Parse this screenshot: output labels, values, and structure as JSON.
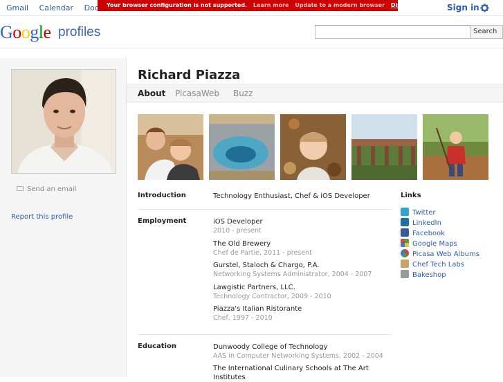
{
  "topbar": {
    "links": [
      "Gmail",
      "Calendar",
      "Docume"
    ],
    "sign_in": "Sign in",
    "warning": {
      "message": "Your browser configuration is not supported.",
      "learn_more": "Learn more",
      "update": "Update to a modern browser",
      "dismiss": "Dismiss"
    }
  },
  "header": {
    "logo_text": "Google",
    "logo_sub": "profiles",
    "search_placeholder": "",
    "search_button": "Search"
  },
  "sidebar": {
    "send_email": "Send an email",
    "report": "Report this profile"
  },
  "profile": {
    "name": "Richard Piazza",
    "tabs": [
      {
        "label": "About",
        "active": true
      },
      {
        "label": "PicasaWeb",
        "active": false
      },
      {
        "label": "Buzz",
        "active": false
      }
    ]
  },
  "sections": {
    "introduction": {
      "label": "Introduction",
      "text": "Technology Enthusiast, Chef & iOS Developer"
    },
    "employment": {
      "label": "Employment",
      "items": [
        {
          "title": "iOS Developer",
          "sub": "2010 - present"
        },
        {
          "title": "The Old Brewery",
          "sub": "Chef de Partie, 2011 - present"
        },
        {
          "title": "Gurstel, Staloch & Chargo, P.A.",
          "sub": "Networking Systems Administrator, 2004 - 2007"
        },
        {
          "title": "Lawgistic Partners, LLC.",
          "sub": "Technology Contractor, 2009 - 2010"
        },
        {
          "title": "Piazza's Italian Ristorante",
          "sub": "Chef, 1997 - 2010"
        }
      ]
    },
    "education": {
      "label": "Education",
      "items": [
        {
          "title": "Dunwoody College of Technology",
          "sub": "AAS in Computer Networking Systems, 2002 - 2004"
        },
        {
          "title": "The International Culinary Schools at The Art",
          "sub": "Institutes"
        }
      ]
    }
  },
  "links": {
    "title": "Links",
    "items": [
      {
        "label": "Twitter",
        "icon": "twitter-icon",
        "color": "#33a3d6"
      },
      {
        "label": "LinkedIn",
        "icon": "linkedin-icon",
        "color": "#1f6fa8"
      },
      {
        "label": "Facebook",
        "icon": "facebook-icon",
        "color": "#3b5998"
      },
      {
        "label": "Google Maps",
        "icon": "google-maps-icon",
        "color": "#4aa04a"
      },
      {
        "label": "Picasa Web Albums",
        "icon": "picasa-icon",
        "color": "#d6452f"
      },
      {
        "label": "Chef Tech Labs",
        "icon": "chef-tech-labs-icon",
        "color": "#c9a36a"
      },
      {
        "label": "Bakeshop",
        "icon": "bakeshop-icon",
        "color": "#9a9a9a"
      }
    ]
  },
  "colors": {
    "link": "#2a5db0",
    "warning_bg": "#cc0000",
    "muted": "#999999"
  }
}
